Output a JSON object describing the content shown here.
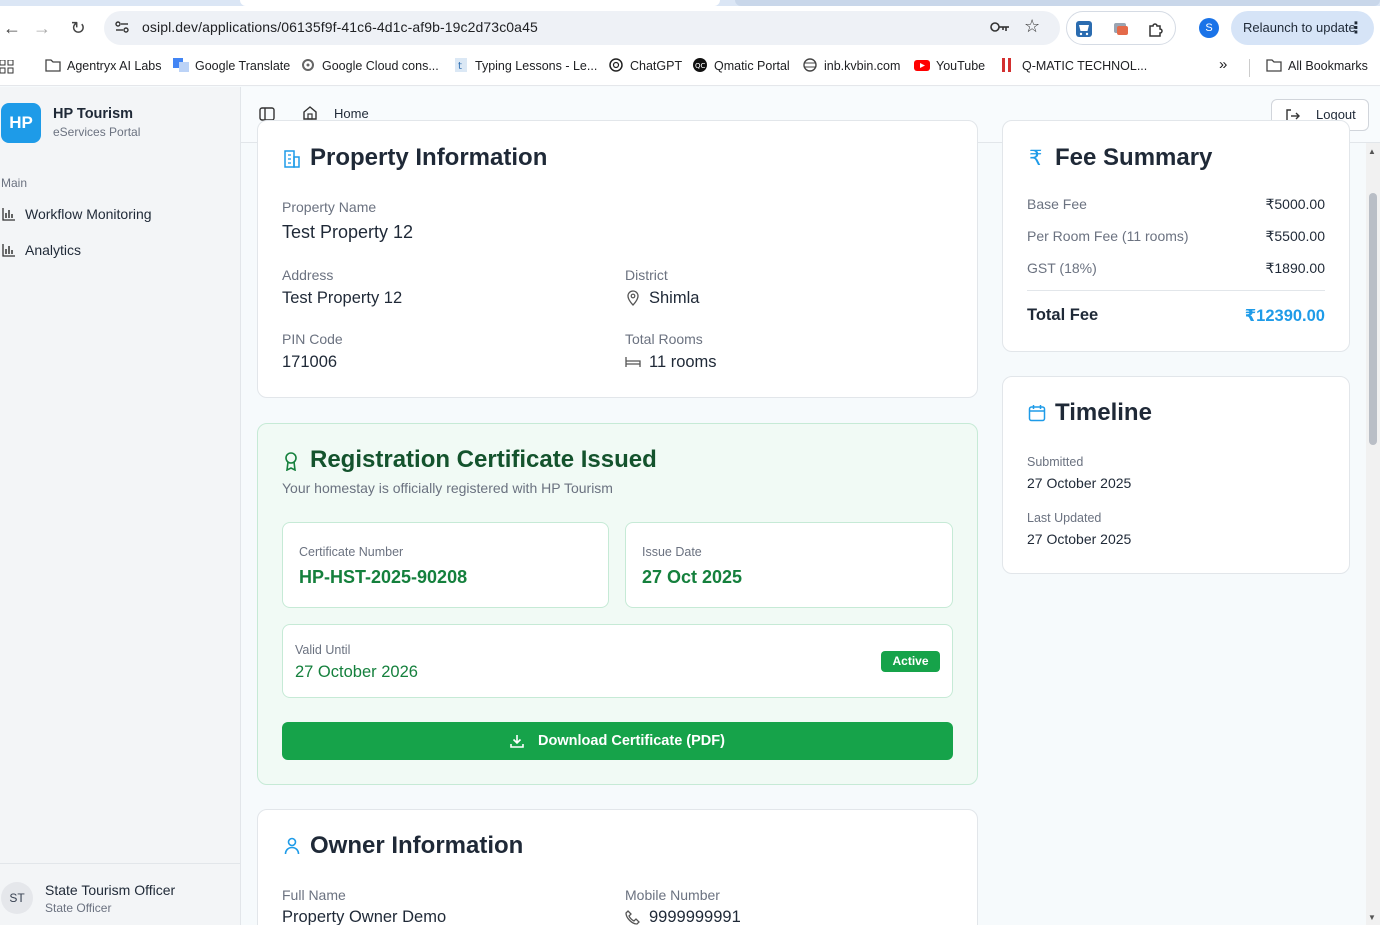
{
  "browser": {
    "url": "osipl.dev/applications/06135f9f-41c6-4d1c-af9b-19c2d73c0a45",
    "profile_initial": "S",
    "relaunch_label": "Relaunch to update"
  },
  "bookmarks": {
    "items": [
      {
        "label": "Agentryx AI Labs",
        "icon": "folder-icon"
      },
      {
        "label": "Google Translate",
        "icon": "translate-icon"
      },
      {
        "label": "Google Cloud cons...",
        "icon": "cloud-icon"
      },
      {
        "label": "Typing Lessons - Le...",
        "icon": "typing-icon"
      },
      {
        "label": "ChatGPT",
        "icon": "chatgpt-icon"
      },
      {
        "label": "Qmatic Portal",
        "icon": "qmatic-icon"
      },
      {
        "label": "inb.kvbin.com",
        "icon": "globe-icon"
      },
      {
        "label": "YouTube",
        "icon": "youtube-icon"
      },
      {
        "label": "Q-MATIC TECHNOL...",
        "icon": "qmatic-tech-icon"
      }
    ],
    "more": "»",
    "all_bookmarks": "All Bookmarks"
  },
  "sidebar": {
    "logo": "HP",
    "brand": "HP Tourism",
    "brand_sub": "eServices Portal",
    "section": "Main",
    "items": [
      {
        "label": "Workflow Monitoring"
      },
      {
        "label": "Analytics"
      }
    ],
    "user": {
      "initials": "ST",
      "name": "State Tourism Officer",
      "role": "State Officer"
    }
  },
  "header": {
    "home": "Home",
    "logout": "Logout"
  },
  "property": {
    "title": "Property Information",
    "name_label": "Property Name",
    "name": "Test Property 12",
    "address_label": "Address",
    "address": "Test Property 12",
    "district_label": "District",
    "district": "Shimla",
    "pin_label": "PIN Code",
    "pin": "171006",
    "rooms_label": "Total Rooms",
    "rooms": "11 rooms"
  },
  "certificate": {
    "title": "Registration Certificate Issued",
    "subtitle": "Your homestay is officially registered with HP Tourism",
    "number_label": "Certificate Number",
    "number": "HP-HST-2025-90208",
    "issue_label": "Issue Date",
    "issue": "27 Oct 2025",
    "valid_label": "Valid Until",
    "valid": "27 October 2026",
    "status": "Active",
    "download": "Download Certificate (PDF)"
  },
  "owner": {
    "title": "Owner Information",
    "name_label": "Full Name",
    "name": "Property Owner Demo",
    "mobile_label": "Mobile Number",
    "mobile": "9999999991"
  },
  "fees": {
    "title": "Fee Summary",
    "rows": [
      {
        "label": "Base Fee",
        "value": "₹5000.00"
      },
      {
        "label": "Per Room Fee (11 rooms)",
        "value": "₹5500.00"
      },
      {
        "label": "GST (18%)",
        "value": "₹1890.00"
      }
    ],
    "total_label": "Total Fee",
    "total": "₹12390.00"
  },
  "timeline": {
    "title": "Timeline",
    "submitted_label": "Submitted",
    "submitted": "27 October 2025",
    "updated_label": "Last Updated",
    "updated": "27 October 2025"
  },
  "colors": {
    "brand": "#1e9be8",
    "success": "#16a34a",
    "success_text": "#15803d"
  }
}
